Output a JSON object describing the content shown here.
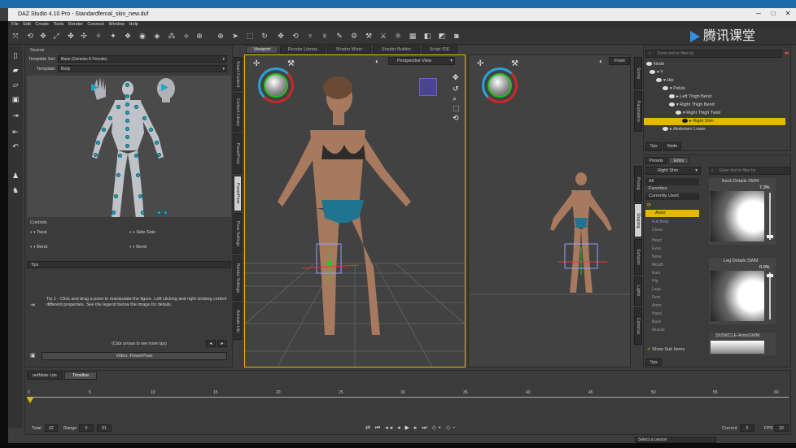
{
  "window": {
    "title": "DAZ Studio 4.10 Pro - Standardfemal_skin_new.duf"
  },
  "menu": [
    "File",
    "Edit",
    "Create",
    "Tools",
    "Render",
    "Connect",
    "Window",
    "Help"
  ],
  "watermark": "腾讯课堂",
  "left_panel": {
    "source_label": "Source",
    "template_set_label": "Template Set:",
    "template_set_value": "Base (Genesis 8 Female)",
    "template_label": "Template:",
    "template_value": "Body",
    "controls_label": "Controls",
    "controls": [
      "Twist",
      "Side-Side",
      "Bend",
      "Bend"
    ],
    "tips_label": "Tips",
    "tip_text": "Tip 1 - Click and drag a point to manipulate the figure. Left clicking and right clicking control different properties. See the legend below the image for details.",
    "click_arrows": "(Click arrows to see more tips)",
    "video_button": "Video: PowerPose",
    "side_tabs": [
      "Smart Content",
      "Content Library",
      "PowerPose",
      "Pose Settings",
      "Render Settings",
      "Animate Lite"
    ]
  },
  "center_tabs": [
    "Viewport",
    "Render Library",
    "Shader Mixer",
    "Shader Builder",
    "Script IDE"
  ],
  "viewport": {
    "view_mode": "Perspective View",
    "right_view": "Front"
  },
  "scene": {
    "search_placeholder": "Enter text to filter by",
    "nodes_label": "Node",
    "tree": [
      "Y",
      "Hip",
      "Pelvis",
      "Left Thigh Bend",
      "Right Thigh Bend",
      "Right Thigh Twist",
      "Right Shin",
      "Abdomen Lower"
    ],
    "selected": "Right Shin",
    "tabs": [
      "Tips",
      "Node"
    ],
    "side_tabs": [
      "Scene",
      "Parameters"
    ]
  },
  "surfaces": {
    "top_tabs": [
      "Presets",
      "Editor"
    ],
    "selector": "Right Shin",
    "filter_placeholder": "Enter text to filter by",
    "categories": [
      "All",
      "Favorites",
      "Currently Used"
    ],
    "actor": "Actor",
    "groups": [
      "Full Body",
      "Chest",
      "Head",
      "Eyes",
      "Nose",
      "Mouth",
      "Ears",
      "Hip",
      "Legs",
      "Feet",
      "Arms",
      "Hand",
      "Back",
      "Muscle"
    ],
    "show_sub_items": "Show Sub Items",
    "side_tabs": [
      "Posing",
      "Shaping",
      "Surfaces",
      "Lights",
      "Cameras"
    ],
    "cards": [
      {
        "name": "Back Details SWM",
        "value": "7.3%"
      },
      {
        "name": "Leg Details SWM",
        "value": "0.0%"
      },
      {
        "name": "ShSWCLE-ArmsSWM",
        "value": ""
      }
    ],
    "tips_tab": "Tips"
  },
  "timeline": {
    "tabs": [
      "aniMate Lite",
      "Timeline"
    ],
    "ticks": [
      "0",
      "5",
      "10",
      "15",
      "20",
      "25",
      "30",
      "35",
      "40",
      "45",
      "50",
      "55",
      "60"
    ],
    "total_label": "Total",
    "total_value": "62",
    "range_label": "Range",
    "range_start": "0",
    "range_end": "61",
    "current_label": "Current",
    "current_value": "0",
    "fps_label": "FPS",
    "fps_value": "30",
    "layer_select": "Select a Lesson"
  }
}
